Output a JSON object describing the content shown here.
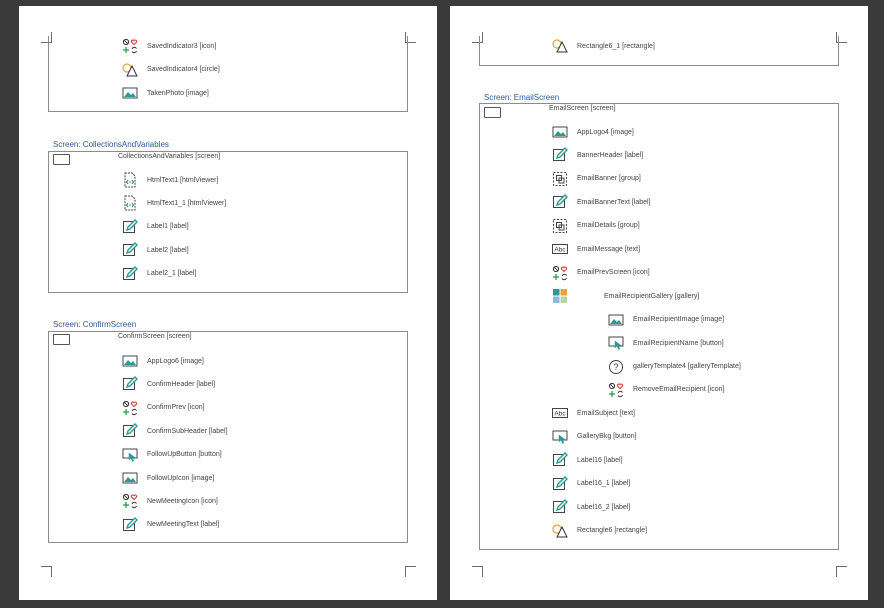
{
  "left_page": {
    "partial_box_items": [
      {
        "label": "SavedIndicator3 [icon]",
        "icon": "icon-control-icon"
      },
      {
        "label": "SavedIndicator4 [circle]",
        "icon": "shape-icon"
      },
      {
        "label": "TakenPhoto [image]",
        "icon": "image-icon"
      }
    ],
    "collections": {
      "title": "Screen: CollectionsAndVariables",
      "screen_label": "CollectionsAndVariables [screen]",
      "items": [
        {
          "label": "HtmlText1 [htmlViewer]",
          "icon": "html-viewer-icon"
        },
        {
          "label": "HtmlText1_1 [htmlViewer]",
          "icon": "html-viewer-icon"
        },
        {
          "label": "Label1 [label]",
          "icon": "label-icon"
        },
        {
          "label": "Label2 [label]",
          "icon": "label-icon"
        },
        {
          "label": "Label2_1 [label]",
          "icon": "label-icon"
        }
      ]
    },
    "confirm": {
      "title": "Screen: ConfirmScreen",
      "screen_label": "ConfirmScreen [screen]",
      "items": [
        {
          "label": "AppLogo6 [image]",
          "icon": "image-icon"
        },
        {
          "label": "ConfirmHeader [label]",
          "icon": "label-icon"
        },
        {
          "label": "ConfirmPrev [icon]",
          "icon": "icon-control-icon"
        },
        {
          "label": "ConfirmSubHeader [label]",
          "icon": "label-icon"
        },
        {
          "label": "FollowUpButton [button]",
          "icon": "button-icon"
        },
        {
          "label": "FollowUpIcon [image]",
          "icon": "image-icon"
        },
        {
          "label": "NewMeetingIcon [icon]",
          "icon": "icon-control-icon"
        },
        {
          "label": "NewMeetingText [label]",
          "icon": "label-icon"
        }
      ]
    }
  },
  "right_page": {
    "partial_box_items": [
      {
        "label": "Rectangle6_1 [rectangle]",
        "icon": "shape-icon"
      }
    ],
    "email": {
      "title": "Screen: EmailScreen",
      "screen_label": "EmailScreen [screen]",
      "items": [
        {
          "label": "AppLogo4 [image]",
          "icon": "image-icon",
          "level": 1
        },
        {
          "label": "BannerHeader [label]",
          "icon": "label-icon",
          "level": 1
        },
        {
          "label": "EmailBanner [group]",
          "icon": "group-icon",
          "level": 1
        },
        {
          "label": "EmailBannerText [label]",
          "icon": "label-icon",
          "level": 1
        },
        {
          "label": "EmailDetails [group]",
          "icon": "group-icon",
          "level": 1
        },
        {
          "label": "EmailMessage [text]",
          "icon": "text-input-icon",
          "level": 1
        },
        {
          "label": "EmailPrevScreen [icon]",
          "icon": "icon-control-icon",
          "level": 1
        },
        {
          "label": "EmailRecipientGallery [gallery]",
          "icon": "gallery-icon",
          "level": 1
        },
        {
          "label": "EmailRecipientImage [image]",
          "icon": "image-icon",
          "level": 2
        },
        {
          "label": "EmailRecipientName [button]",
          "icon": "button-icon",
          "level": 2
        },
        {
          "label": "galleryTemplate4 [galleryTemplate]",
          "icon": "question-icon",
          "level": 2
        },
        {
          "label": "RemoveEmailRecipient [icon]",
          "icon": "icon-control-icon",
          "level": 2
        },
        {
          "label": "EmailSubject [text]",
          "icon": "text-input-icon",
          "level": 1
        },
        {
          "label": "GalleryBkg [button]",
          "icon": "button-icon",
          "level": 1
        },
        {
          "label": "Label16 [label]",
          "icon": "label-icon",
          "level": 1
        },
        {
          "label": "Label16_1 [label]",
          "icon": "label-icon",
          "level": 1
        },
        {
          "label": "Label16_2 [label]",
          "icon": "label-icon",
          "level": 1
        },
        {
          "label": "Rectangle6 [rectangle]",
          "icon": "shape-icon",
          "level": 1
        }
      ],
      "text_icon_glyph": "Abc",
      "question_glyph": "?"
    }
  },
  "colors": {
    "title": "#2e5a97",
    "teal": "#2b9a96",
    "orange": "#e8a33a",
    "green": "#2e9e4f",
    "red": "#d9342b",
    "page_bg": "#3a3a3a"
  }
}
